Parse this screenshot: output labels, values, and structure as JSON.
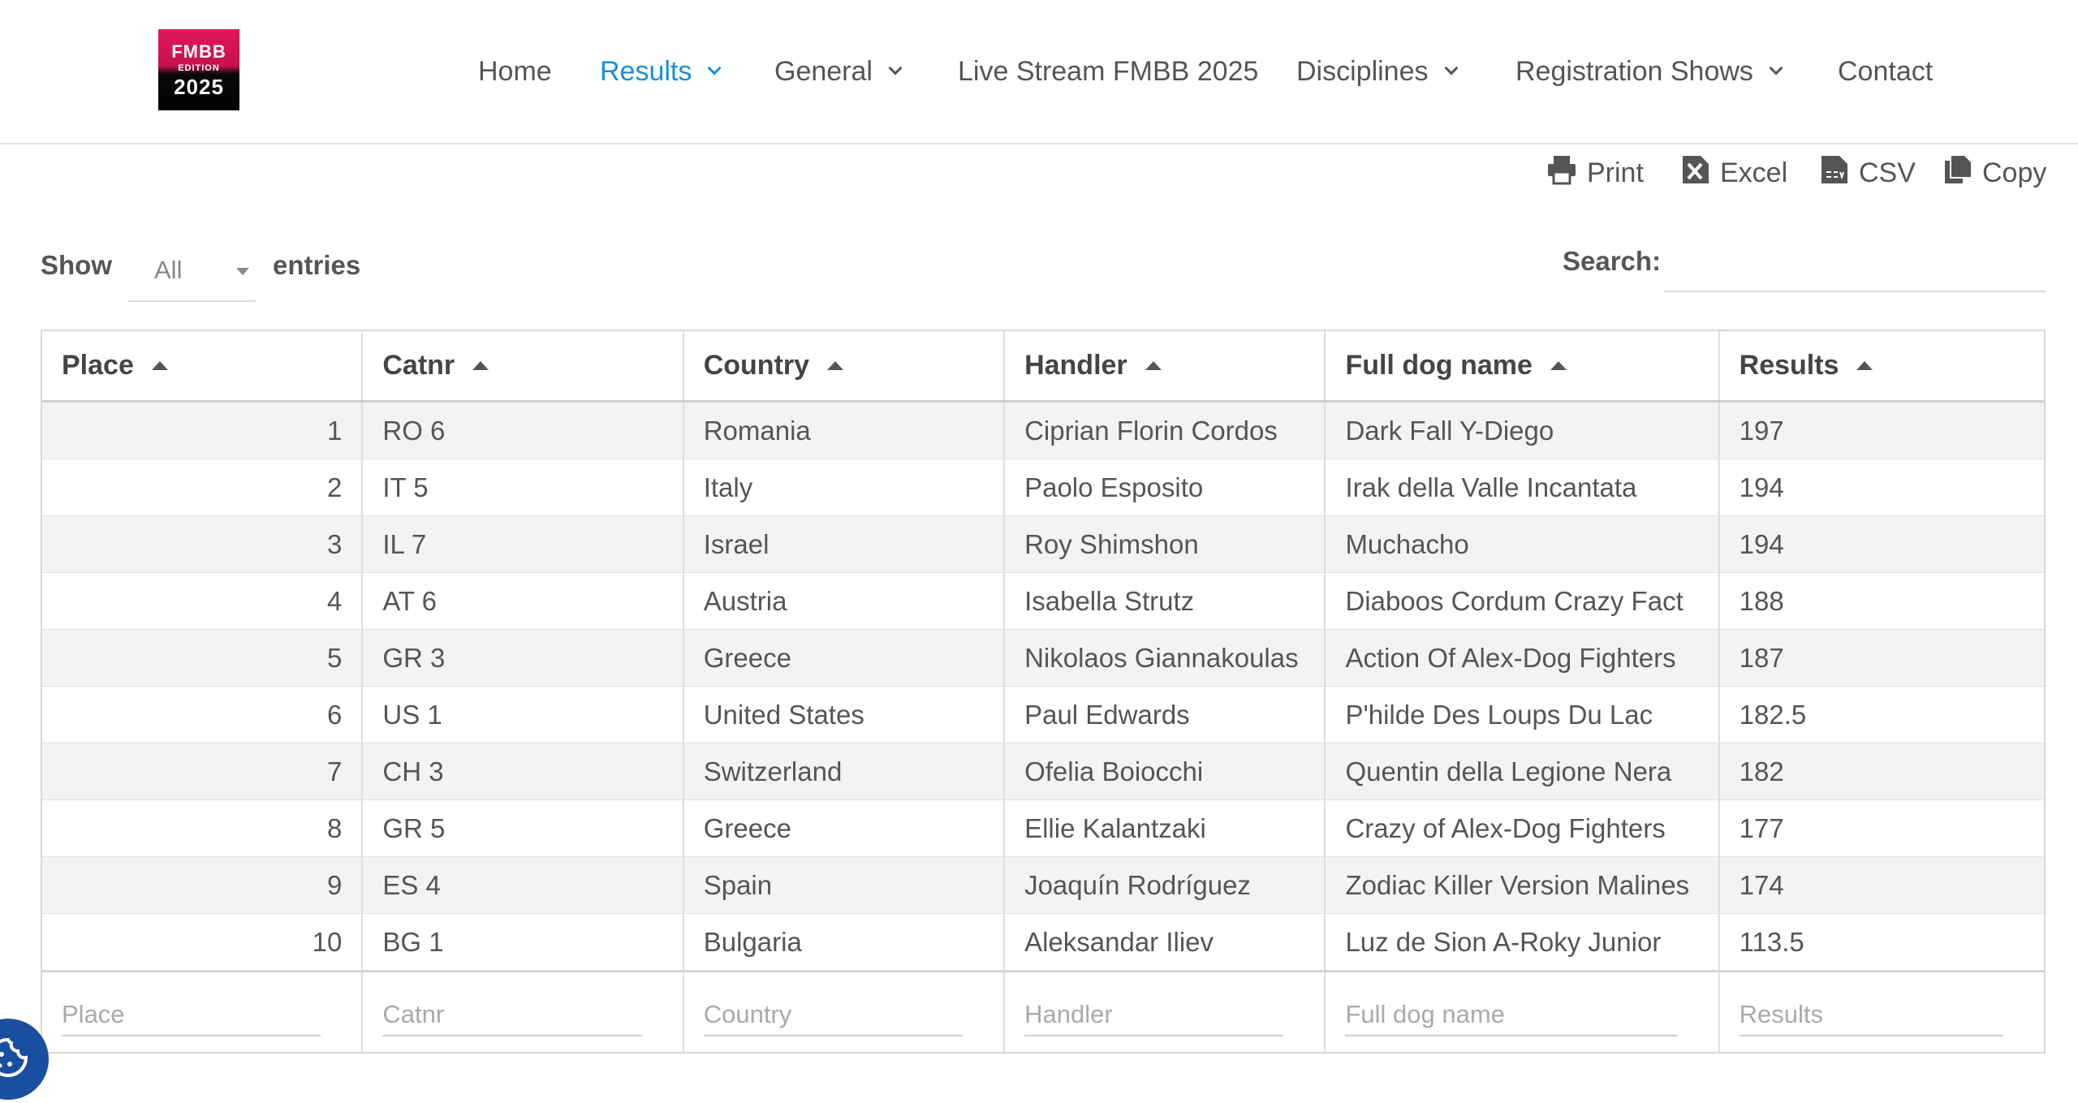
{
  "logo": {
    "line1": "FMBB",
    "line2": "EDITION",
    "line3": "2025"
  },
  "nav": {
    "items": [
      {
        "label": "Home"
      },
      {
        "label": "Results"
      },
      {
        "label": "General"
      },
      {
        "label": "Live Stream FMBB 2025"
      },
      {
        "label": "Disciplines"
      },
      {
        "label": "Registration Shows"
      },
      {
        "label": "Contact"
      }
    ],
    "active_color": "#1b8fd6"
  },
  "export": {
    "print": "Print",
    "excel": "Excel",
    "csv": "CSV",
    "copy": "Copy"
  },
  "length": {
    "show": "Show",
    "selected": "All",
    "entries": "entries"
  },
  "search": {
    "label": "Search:",
    "value": ""
  },
  "table": {
    "columns": [
      "Place",
      "Catnr",
      "Country",
      "Handler",
      "Full dog name",
      "Results"
    ],
    "rows": [
      [
        "1",
        "RO 6",
        "Romania",
        "Ciprian Florin Cordos",
        "Dark Fall Y-Diego",
        "197"
      ],
      [
        "2",
        "IT 5",
        "Italy",
        "Paolo Esposito",
        "Irak della Valle Incantata",
        "194"
      ],
      [
        "3",
        "IL 7",
        "Israel",
        "Roy Shimshon",
        "Muchacho",
        "194"
      ],
      [
        "4",
        "AT 6",
        "Austria",
        "Isabella Strutz",
        "Diaboos Cordum Crazy Fact",
        "188"
      ],
      [
        "5",
        "GR 3",
        "Greece",
        "Nikolaos Giannakoulas",
        "Action Of Alex-Dog Fighters",
        "187"
      ],
      [
        "6",
        "US 1",
        "United States",
        "Paul Edwards",
        "P'hilde Des Loups Du Lac",
        "182.5"
      ],
      [
        "7",
        "CH 3",
        "Switzerland",
        "Ofelia Boiocchi",
        "Quentin della Legione Nera",
        "182"
      ],
      [
        "8",
        "GR 5",
        "Greece",
        "Ellie Kalantzaki",
        "Crazy of Alex-Dog Fighters",
        "177"
      ],
      [
        "9",
        "ES 4",
        "Spain",
        "Joaquín Rodríguez",
        "Zodiac Killer Version Malines",
        "174"
      ],
      [
        "10",
        "BG 1",
        "Bulgaria",
        "Aleksandar Iliev",
        "Luz de Sion A-Roky Junior",
        "113.5"
      ]
    ],
    "filter_placeholders": [
      "Place",
      "Catnr",
      "Country",
      "Handler",
      "Full dog name",
      "Results"
    ]
  },
  "colors": {
    "cookie_button": "#1a4fa0",
    "logo_pink": "#e0175e"
  }
}
